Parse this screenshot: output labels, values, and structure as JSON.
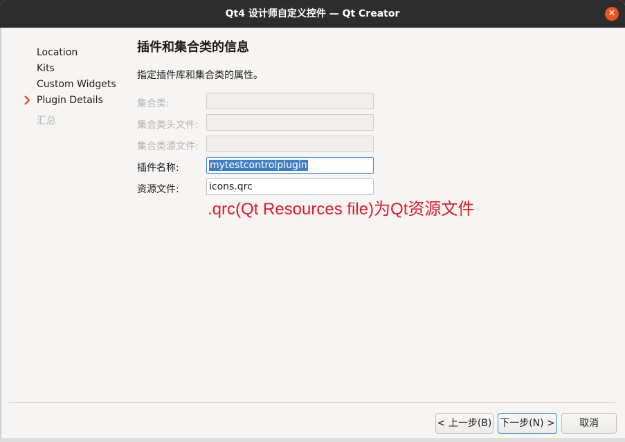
{
  "window": {
    "title": "Qt4 设计师自定义控件 — Qt Creator",
    "close_symbol": "✕"
  },
  "nav": {
    "items": [
      {
        "label": "Location",
        "state": "done"
      },
      {
        "label": "Kits",
        "state": "done"
      },
      {
        "label": "Custom Widgets",
        "state": "done"
      },
      {
        "label": "Plugin Details",
        "state": "current"
      },
      {
        "label": "汇总",
        "state": "pending"
      }
    ]
  },
  "page": {
    "heading": "插件和集合类的信息",
    "description": "指定插件库和集合类的属性。"
  },
  "form": {
    "collection_class": {
      "label": "集合类:",
      "value": "",
      "enabled": false
    },
    "collection_header": {
      "label": "集合类头文件:",
      "value": "",
      "enabled": false
    },
    "collection_source": {
      "label": "集合类源文件:",
      "value": "",
      "enabled": false
    },
    "plugin_name": {
      "label": "插件名称:",
      "value": "mytestcontrolplugin",
      "enabled": true
    },
    "resource_file": {
      "label": "资源文件:",
      "value": "icons.qrc",
      "enabled": true
    }
  },
  "annotation": {
    "text": ".qrc(Qt Resources file)为Qt资源文件",
    "color": "#e01b24"
  },
  "buttons": {
    "back": "< 上一步(B)",
    "next": "下一步(N) >",
    "cancel": "取消"
  },
  "colors": {
    "accent": "#e95420",
    "selection": "#3d7ec6",
    "focus": "#3584e4"
  }
}
